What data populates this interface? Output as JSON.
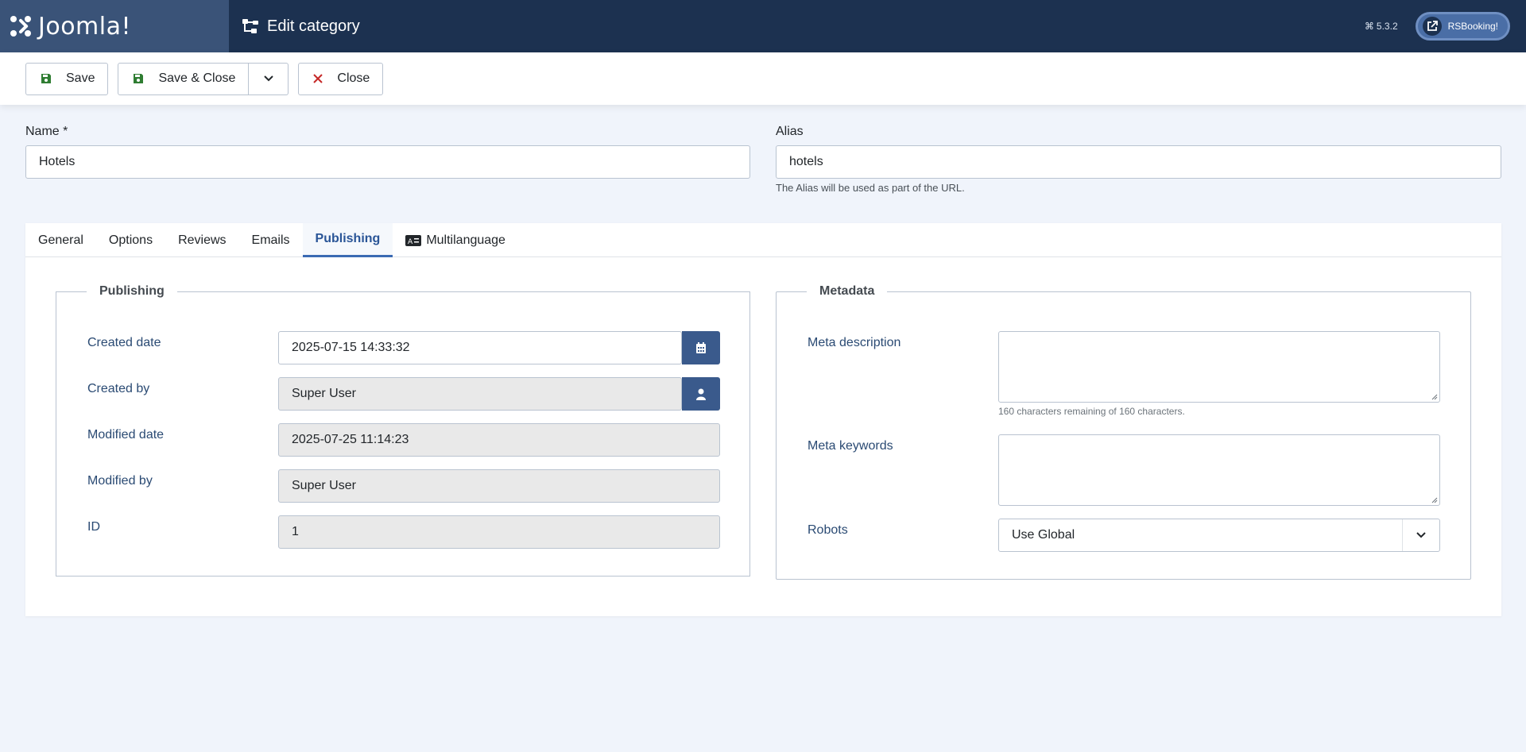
{
  "header": {
    "logo_text": "Joomla!",
    "title": "Edit category",
    "version": "5.3.2",
    "site_button_label": "RSBooking!"
  },
  "toolbar": {
    "save_label": "Save",
    "save_close_label": "Save & Close",
    "close_label": "Close"
  },
  "form": {
    "name_label": "Name *",
    "name_value": "Hotels",
    "alias_label": "Alias",
    "alias_value": "hotels",
    "alias_hint": "The Alias will be used as part of the URL."
  },
  "tabs": [
    "General",
    "Options",
    "Reviews",
    "Emails",
    "Publishing",
    "Multilanguage"
  ],
  "active_tab": "Publishing",
  "publishing": {
    "legend": "Publishing",
    "created_date_label": "Created date",
    "created_date_value": "2025-07-15 14:33:32",
    "created_by_label": "Created by",
    "created_by_value": "Super User",
    "modified_date_label": "Modified date",
    "modified_date_value": "2025-07-25 11:14:23",
    "modified_by_label": "Modified by",
    "modified_by_value": "Super User",
    "id_label": "ID",
    "id_value": "1"
  },
  "metadata": {
    "legend": "Metadata",
    "meta_description_label": "Meta description",
    "meta_description_value": "",
    "meta_description_hint": "160 characters remaining of 160 characters.",
    "meta_keywords_label": "Meta keywords",
    "meta_keywords_value": "",
    "robots_label": "Robots",
    "robots_value": "Use Global"
  },
  "colors": {
    "header_bg": "#1c3150",
    "accent": "#3a5a8c",
    "close_icon": "#c52827",
    "active_tab": "#2a5597"
  }
}
